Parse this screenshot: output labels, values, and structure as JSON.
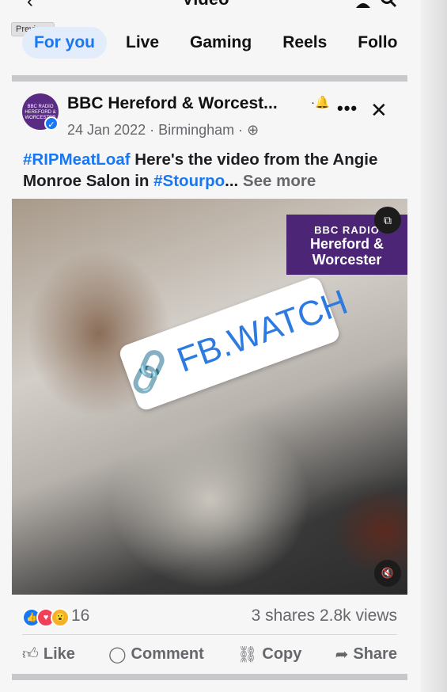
{
  "header": {
    "back_label": "‹",
    "title": "Video"
  },
  "tooltip": {
    "previous": "Previous"
  },
  "tabs": [
    {
      "label": "For you"
    },
    {
      "label": "Live"
    },
    {
      "label": "Gaming"
    },
    {
      "label": "Reels"
    },
    {
      "label": "Follo"
    }
  ],
  "post": {
    "page_name": "BBC Hereford & Worcest...",
    "avatar_text": "BBC RADIO HEREFORD & WORCESTER",
    "date": "24 Jan 2022",
    "location": "Birmingham",
    "separator": "·",
    "caption": {
      "hashtag1": "#RIPMeatLoaf",
      "text1": " Here's the video from the Angie Monroe Salon in ",
      "hashtag2": "#Stourpo",
      "ellipsis": "... ",
      "see_more": "See more"
    }
  },
  "video": {
    "brand_line1": "BBC RADIO",
    "brand_line2": "Hereford &",
    "brand_line3": "Worcester",
    "sticker_text": "FB.WATCH",
    "pip_icon": "⧉",
    "mute_icon": "🔇"
  },
  "stats": {
    "reaction_count": "16",
    "shares": "3 shares",
    "views": "2.8k views"
  },
  "actions": {
    "like": "Like",
    "comment": "Comment",
    "copy": "Copy",
    "share": "Share"
  },
  "colors": {
    "accent": "#1877f2",
    "brand_purple": "#4d2577",
    "muted": "#65676b"
  }
}
